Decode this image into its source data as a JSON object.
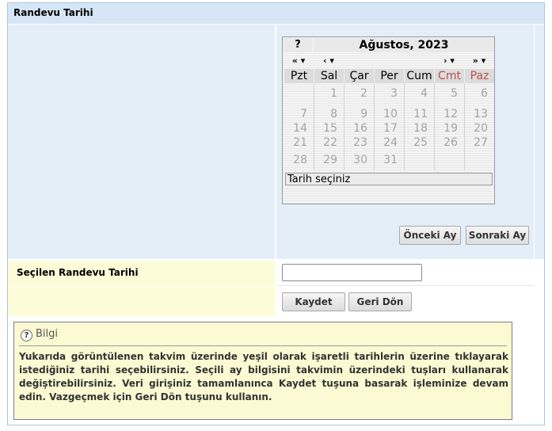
{
  "section": {
    "title": "Randevu Tarihi"
  },
  "calendar": {
    "help_button": "?",
    "month_title": "Ağustos, 2023",
    "nav": {
      "prev_year": "«",
      "prev_month": "‹",
      "next_month": "›",
      "next_year": "»"
    },
    "weekdays": [
      "Pzt",
      "Sal",
      "Çar",
      "Per",
      "Cum",
      "Cmt",
      "Paz"
    ],
    "weeks": [
      [
        "",
        "1",
        "2",
        "3",
        "4",
        "5",
        "6"
      ],
      [
        "7",
        "8",
        "9",
        "10",
        "11",
        "12",
        "13"
      ],
      [
        "14",
        "15",
        "16",
        "17",
        "18",
        "19",
        "20"
      ],
      [
        "21",
        "22",
        "23",
        "24",
        "25",
        "26",
        "27"
      ],
      [
        "28",
        "29",
        "30",
        "31",
        "",
        "",
        ""
      ]
    ],
    "status_text": "Tarih seçiniz",
    "colors": {
      "weekend_header": "#c0504d",
      "day_text": "#a4a4a4"
    }
  },
  "buttons": {
    "prev_month": "Önceki Ay",
    "next_month": "Sonraki Ay",
    "save": "Kaydet",
    "back": "Geri Dön"
  },
  "form": {
    "selected_date_label": "Seçilen Randevu Tarihi",
    "selected_date_value": ""
  },
  "info": {
    "title": "Bilgi",
    "text": "Yukarıda görüntülenen takvim üzerinde yeşil olarak işaretli tarihlerin üzerine tıklayarak istediğiniz tarihi seçebilirsiniz. Seçili ay bilgisini takvimin üzerindeki tuşları kullanarak değiştirebilirsiniz. Veri girişiniz tamamlanınca Kaydet tuşuna basarak işleminize devam edin. Vazgeçmek için Geri Dön tuşunu kullanın."
  }
}
